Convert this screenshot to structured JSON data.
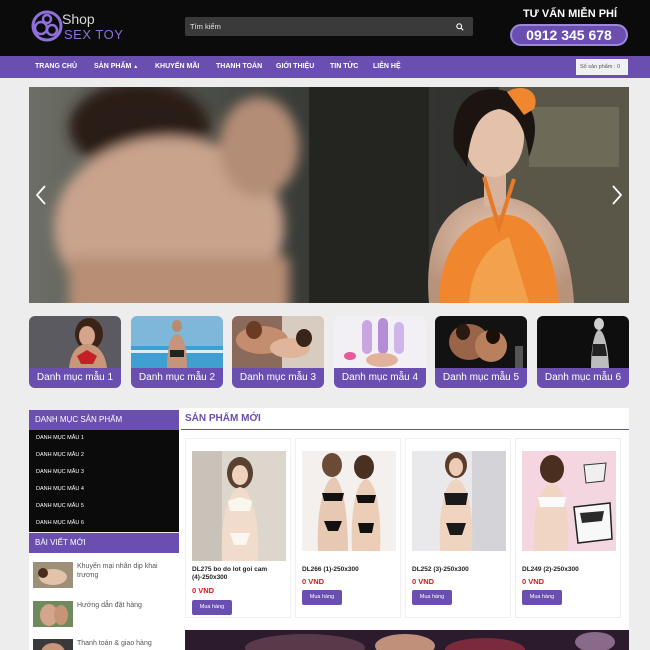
{
  "brand": {
    "line1": "Shop",
    "line2": "SEX TOY"
  },
  "search": {
    "placeholder": "Tìm kiếm"
  },
  "hotline": {
    "label": "TƯ VẤN MIỄN PHÍ",
    "phone": "0912 345 678"
  },
  "nav": [
    "TRANG CHỦ",
    "SẢN PHẨM",
    "KHUYẾN MÃI",
    "THANH TOÁN",
    "GIỚI THIỆU",
    "TIN TỨC",
    "LIÊN HỆ"
  ],
  "cart": {
    "label": "Số sản phẩm : 0"
  },
  "categories": [
    "Danh mục mẫu 1",
    "Danh mục mẫu 2",
    "Danh mục mẫu 3",
    "Danh mục mẫu 4",
    "Danh mục mẫu 5",
    "Danh mục mẫu 6"
  ],
  "sidebar": {
    "heading": "DANH MỤC SẢN PHẨM",
    "items": [
      "DANH MỤC MẪU 1",
      "DANH MỤC MẪU 2",
      "DANH MỤC MẪU 3",
      "DANH MỤC MẪU 4",
      "DANH MỤC MẪU 5",
      "DANH MỤC MẪU 6"
    ],
    "posts_heading": "BÀI VIẾT MỚI",
    "posts": [
      "Khuyến mại nhân dịp khai trương",
      "Hướng dẫn đặt hàng",
      "Thanh toán & giao hàng"
    ]
  },
  "products": {
    "heading": "SẢN PHẨM MỚI",
    "items": [
      {
        "name": "DL275 bo do lot goi cam (4)-250x300",
        "price": "0 VND",
        "buy": "Mua hàng"
      },
      {
        "name": "DL266 (1)-250x300",
        "price": "0 VND",
        "buy": "Mua hàng"
      },
      {
        "name": "DL252 (3)-250x300",
        "price": "0 VND",
        "buy": "Mua hàng"
      },
      {
        "name": "DL249 (2)-250x300",
        "price": "0 VND",
        "buy": "Mua hàng"
      }
    ]
  },
  "colors": {
    "accent": "#6a4fb0",
    "header_bg": "#0b0b0b",
    "price": "#e0141e"
  },
  "icons": [
    "logo-mark-icon",
    "search-icon",
    "caret-down-icon",
    "chevron-left-icon",
    "chevron-right-icon"
  ]
}
